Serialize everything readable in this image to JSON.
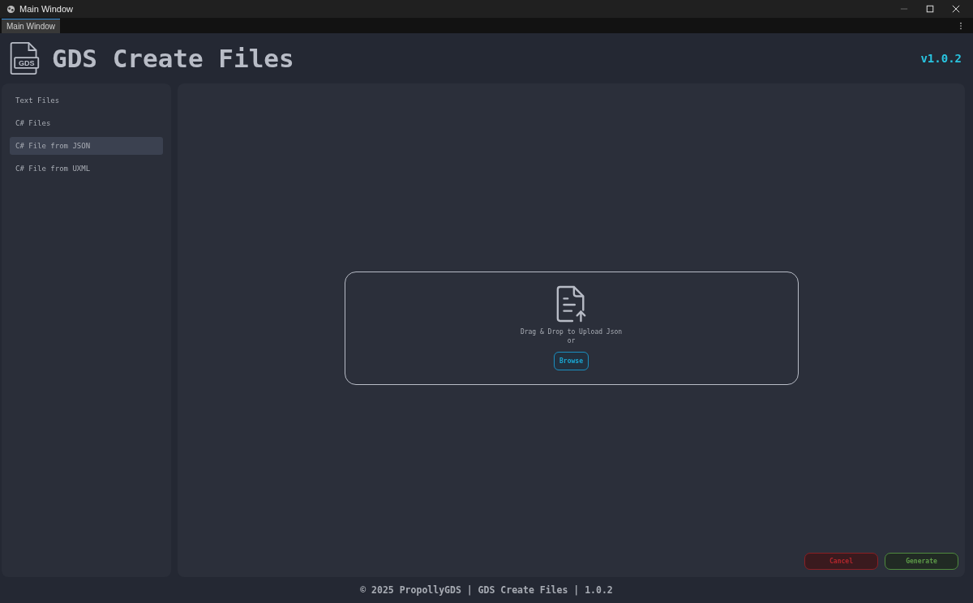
{
  "window": {
    "title": "Main Window"
  },
  "tabs": [
    {
      "label": "Main Window",
      "selected": true
    }
  ],
  "header": {
    "title": "GDS Create Files",
    "logo_text": "GDS",
    "version": "v1.0.2"
  },
  "sidebar": {
    "items": [
      {
        "label": "Text Files",
        "selected": false
      },
      {
        "label": "C# Files",
        "selected": false
      },
      {
        "label": "C# File from JSON",
        "selected": true
      },
      {
        "label": "C# File from UXML",
        "selected": false
      }
    ]
  },
  "upload": {
    "prompt": "Drag & Drop to Upload Json",
    "or": "or",
    "button": "Browse"
  },
  "actions": [
    {
      "label": "Cancel",
      "kind": "danger"
    },
    {
      "label": "Generate",
      "kind": "success"
    }
  ],
  "footer": "© 2025 PropollyGDS | GDS Create Files | 1.0.2"
}
